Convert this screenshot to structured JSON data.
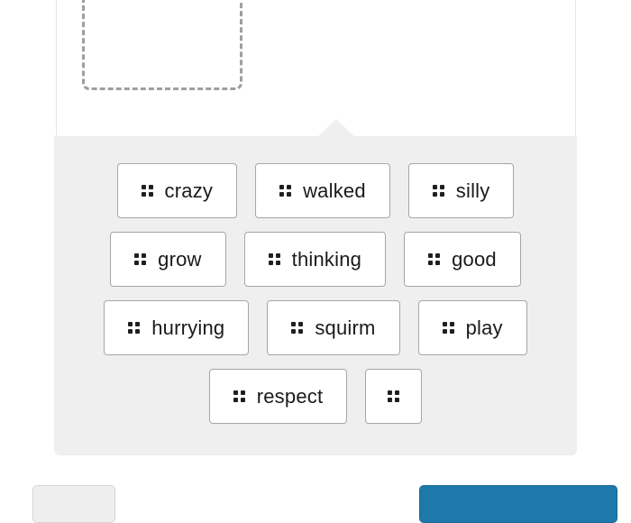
{
  "colors": {
    "panel_bg": "#efefef",
    "chip_bg": "#ffffff",
    "chip_border": "#a6a6a6",
    "primary_button": "#1f78aa",
    "secondary_button": "#eeeeee",
    "dropzone_dash": "#9e9e9e"
  },
  "drop_zone": {
    "name": "answer-drop-zone",
    "style": "dashed"
  },
  "word_bank": {
    "handle_icon": "drag-handle-dots-icon",
    "rows": [
      [
        {
          "label": "crazy"
        },
        {
          "label": "walked"
        },
        {
          "label": "silly"
        }
      ],
      [
        {
          "label": "grow"
        },
        {
          "label": "thinking"
        },
        {
          "label": "good"
        }
      ],
      [
        {
          "label": "hurrying"
        },
        {
          "label": "squirm"
        },
        {
          "label": "play"
        }
      ],
      [
        {
          "label": "respect"
        },
        {
          "label": ""
        }
      ]
    ]
  },
  "footer": {
    "secondary_label": "",
    "primary_label": ""
  }
}
